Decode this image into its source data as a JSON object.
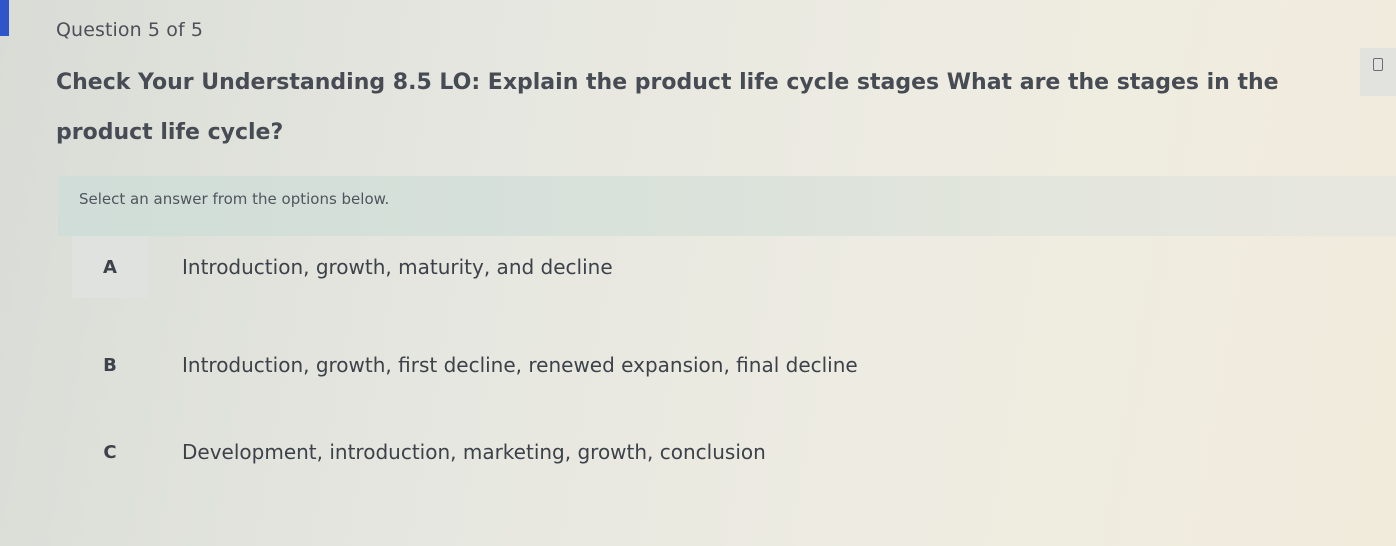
{
  "header": {
    "question_counter": "Question 5 of 5"
  },
  "question": {
    "text": "Check Your Understanding 8.5 LO: Explain the product life cycle stages What are the stages in the product life cycle?"
  },
  "instruction": "Select an answer from the options below.",
  "options": [
    {
      "letter": "A",
      "text": "Introduction, growth, maturity, and decline"
    },
    {
      "letter": "B",
      "text": "Introduction, growth, first decline, renewed expansion, final decline"
    },
    {
      "letter": "C",
      "text": "Development, introduction, marketing, growth, conclusion"
    }
  ],
  "icons": {
    "bookmark": "bookmark-icon"
  },
  "colors": {
    "accent": "#2f56c8",
    "instruction_bar": "#d6e0da",
    "text": "#474b54"
  }
}
